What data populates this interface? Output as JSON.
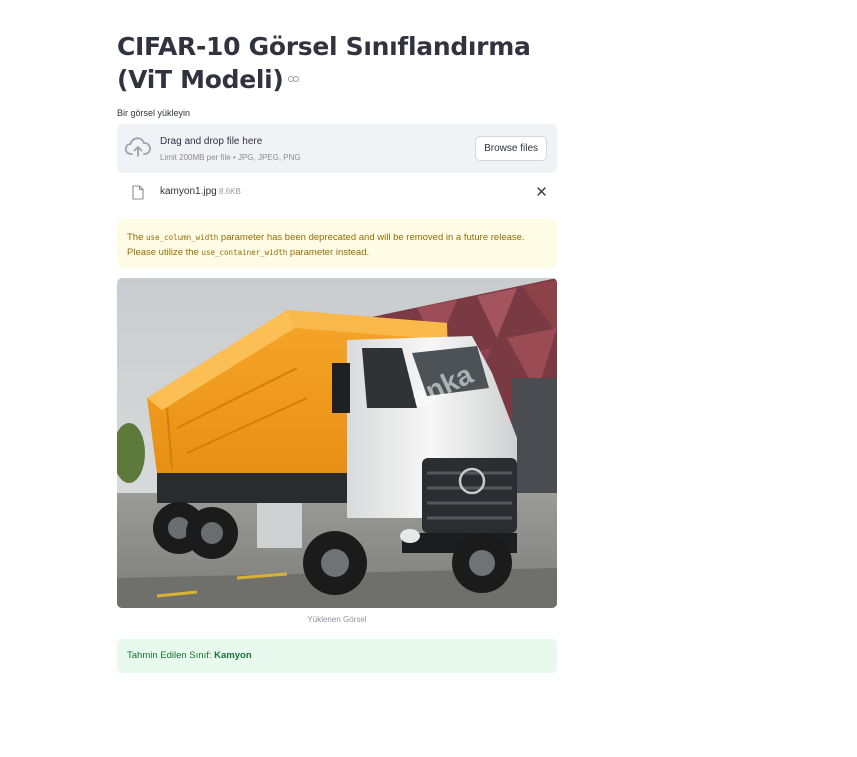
{
  "page": {
    "title": "CIFAR-10 Görsel Sınıflandırma (ViT Modeli)"
  },
  "uploader": {
    "label": "Bir görsel yükleyin",
    "drop_text": "Drag and drop file here",
    "limit_text": "Limit 200MB per file • JPG, JPEG, PNG",
    "browse_label": "Browse files"
  },
  "uploaded_file": {
    "name": "kamyon1.jpg",
    "size": "8.6KB"
  },
  "warning": {
    "prefix": "The ",
    "code1": "use_column_width",
    "middle": " parameter has been deprecated and will be removed in a future release. Please utilize the ",
    "code2": "use_container_width",
    "suffix": " parameter instead."
  },
  "image": {
    "caption": "Yüklenen Görsel",
    "watermark": "anka"
  },
  "result": {
    "prefix": "Tahmin Edilen Sınıf: ",
    "class_name": "Kamyon"
  },
  "icons": {
    "anchor": "link-icon",
    "upload": "cloud-upload-icon",
    "file": "file-icon",
    "remove": "close-icon"
  },
  "colors": {
    "text": "#31333f",
    "dropzone_bg": "#f0f2f6",
    "warning_bg": "#fffce6",
    "warning_text": "#926c05",
    "success_bg": "#e8f9ee",
    "success_text": "#177233"
  }
}
